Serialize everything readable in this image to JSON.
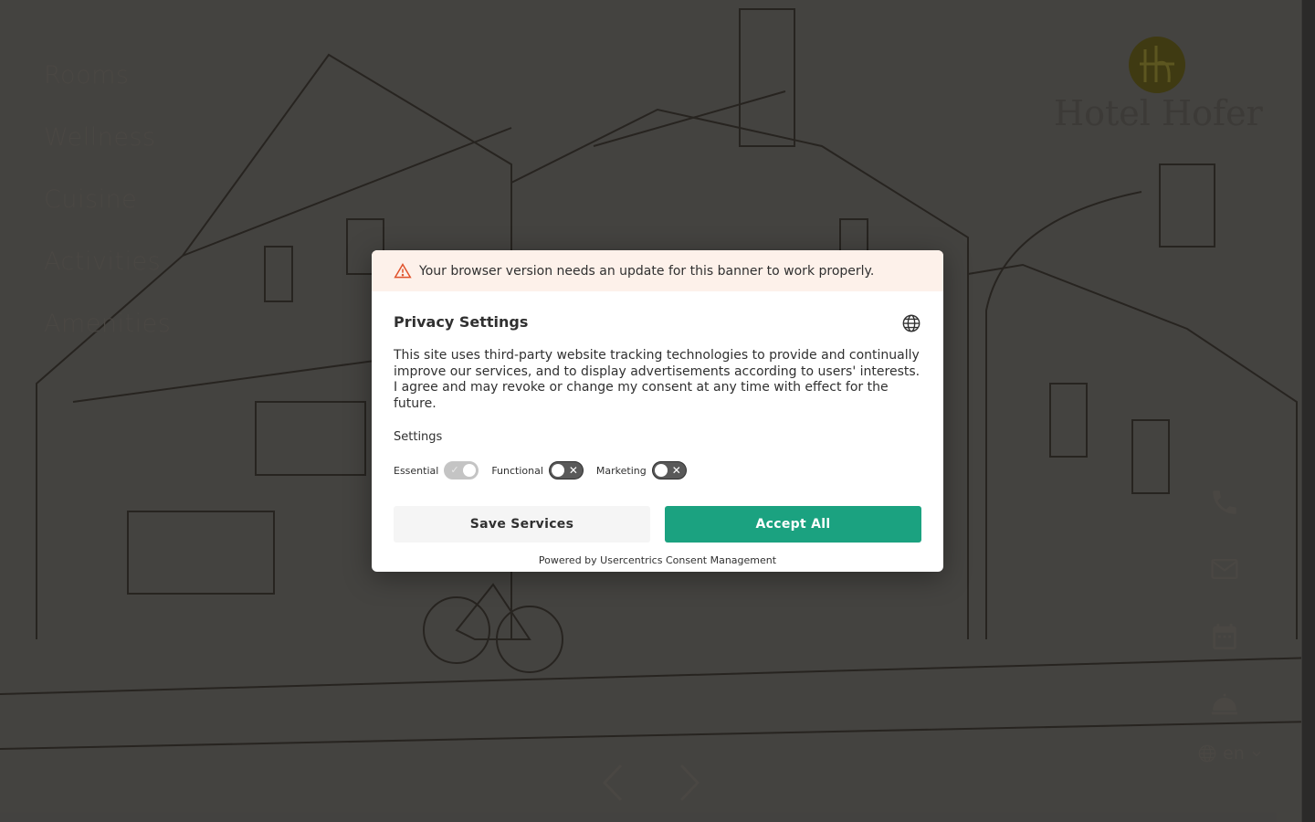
{
  "nav": {
    "items": [
      {
        "label": "Rooms"
      },
      {
        "label": "Wellness"
      },
      {
        "label": "Cuisine"
      },
      {
        "label": "Activities"
      },
      {
        "label": "Amenities"
      }
    ]
  },
  "logo": {
    "name": "Hotel Hofer"
  },
  "side_icons": [
    {
      "icon": "phone-icon"
    },
    {
      "icon": "mail-icon"
    },
    {
      "icon": "calendar-icon"
    },
    {
      "icon": "reception-bell-icon"
    }
  ],
  "language": {
    "current": "en"
  },
  "colors": {
    "accent": "#1ba280",
    "warning_bg": "#fdf1ea",
    "warning_icon": "#e0522b",
    "overlay": "#141414"
  },
  "consent": {
    "warning_text": "Your browser version needs an update for this banner to work properly.",
    "title": "Privacy Settings",
    "description": "This site uses third-party website tracking technologies to provide and continually improve our services, and to display advertisements according to users' interests. I agree and may revoke or change my consent at any time with effect for the future.",
    "settings_label": "Settings",
    "toggles": [
      {
        "label": "Essential",
        "state": "on-disabled"
      },
      {
        "label": "Functional",
        "state": "off"
      },
      {
        "label": "Marketing",
        "state": "off"
      }
    ],
    "save_label": "Save Services",
    "accept_label": "Accept All",
    "powered_by": "Powered by Usercentrics Consent Management"
  }
}
